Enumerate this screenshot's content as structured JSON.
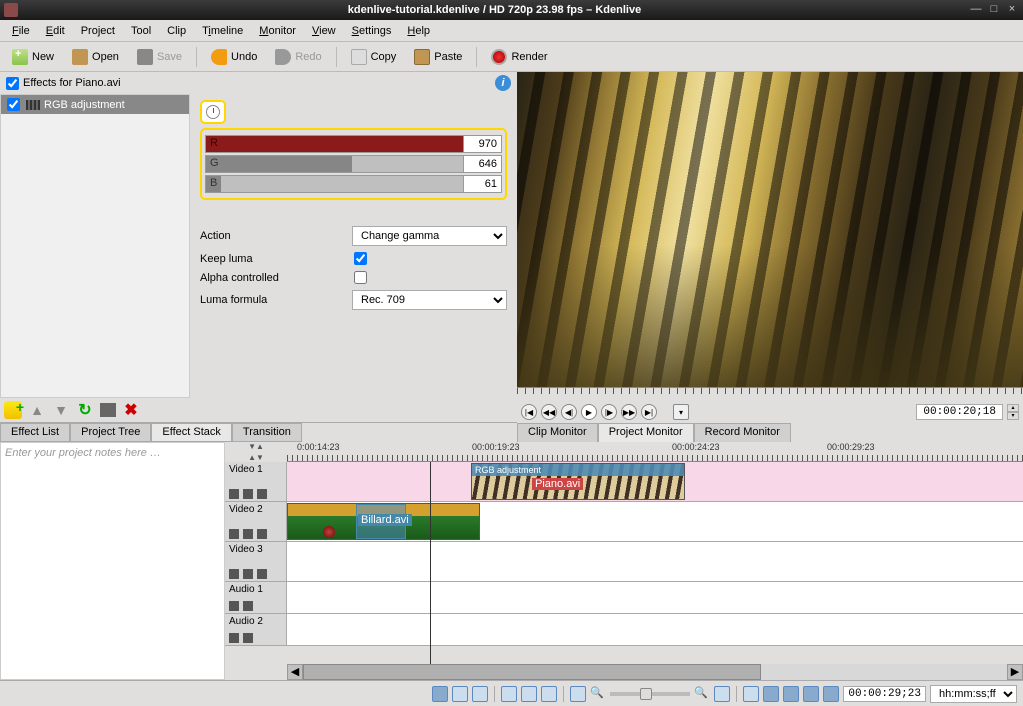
{
  "window": {
    "title": "kdenlive-tutorial.kdenlive / HD 720p 23.98 fps – Kdenlive"
  },
  "menu": {
    "file": "File",
    "edit": "Edit",
    "project": "Project",
    "tool": "Tool",
    "clip": "Clip",
    "timeline": "Timeline",
    "monitor": "Monitor",
    "view": "View",
    "settings": "Settings",
    "help": "Help"
  },
  "toolbar": {
    "new": "New",
    "open": "Open",
    "save": "Save",
    "undo": "Undo",
    "redo": "Redo",
    "copy": "Copy",
    "paste": "Paste",
    "render": "Render"
  },
  "effects": {
    "header": "Effects for Piano.avi",
    "item": "RGB adjustment",
    "r_label": "R",
    "g_label": "G",
    "b_label": "B",
    "r_val": "970",
    "g_val": "646",
    "b_val": "61",
    "action_label": "Action",
    "action_value": "Change gamma",
    "keep_luma": "Keep luma",
    "alpha_ctrl": "Alpha controlled",
    "luma_formula": "Luma formula",
    "luma_value": "Rec. 709"
  },
  "bottom_tabs": {
    "effect_list": "Effect List",
    "project_tree": "Project Tree",
    "effect_stack": "Effect Stack",
    "transition": "Transition"
  },
  "monitor": {
    "tc": "00:00:20;18",
    "tabs": {
      "clip": "Clip Monitor",
      "project": "Project Monitor",
      "record": "Record Monitor"
    }
  },
  "notes": {
    "placeholder": "Enter your project notes here …"
  },
  "timeline": {
    "ticks": [
      "0:00:14:23",
      "00:00:19:23",
      "00:00:24:23",
      "00:00:29:23"
    ],
    "tracks": {
      "v1": "Video 1",
      "v2": "Video 2",
      "v3": "Video 3",
      "a1": "Audio 1",
      "a2": "Audio 2"
    },
    "clips": {
      "piano_fx": "RGB adjustment",
      "piano_name": "Piano.avi",
      "billard_name": "Billard.avi"
    }
  },
  "status": {
    "tc": "00:00:29;23",
    "tc_format": "hh:mm:ss;ff"
  }
}
